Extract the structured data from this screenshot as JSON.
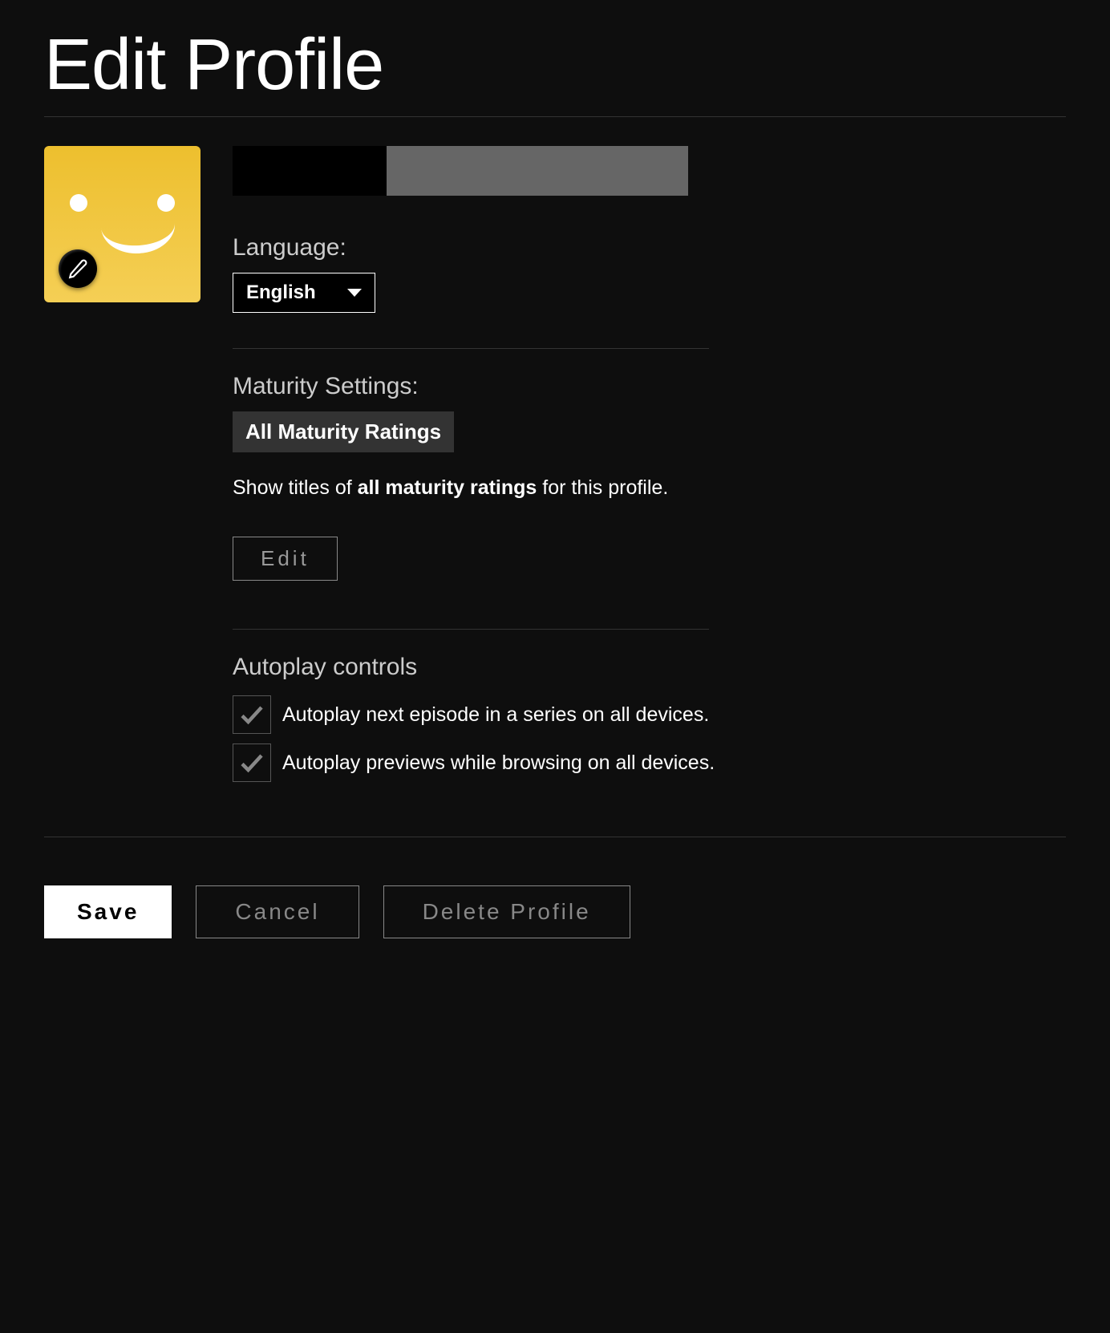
{
  "page_title": "Edit Profile",
  "profile": {
    "name": "",
    "avatar_color_top": "#edbf2e",
    "avatar_color_bottom": "#f5cf55"
  },
  "language": {
    "label": "Language:",
    "selected": "English"
  },
  "maturity": {
    "label": "Maturity Settings:",
    "chip": "All Maturity Ratings",
    "desc_prefix": "Show titles of ",
    "desc_bold": "all maturity ratings",
    "desc_suffix": " for this profile.",
    "edit_label": "Edit"
  },
  "autoplay": {
    "label": "Autoplay controls",
    "next_episode": {
      "checked": true,
      "label": "Autoplay next episode in a series on all devices."
    },
    "previews": {
      "checked": true,
      "label": "Autoplay previews while browsing on all devices."
    }
  },
  "actions": {
    "save": "Save",
    "cancel": "Cancel",
    "delete": "Delete Profile"
  }
}
